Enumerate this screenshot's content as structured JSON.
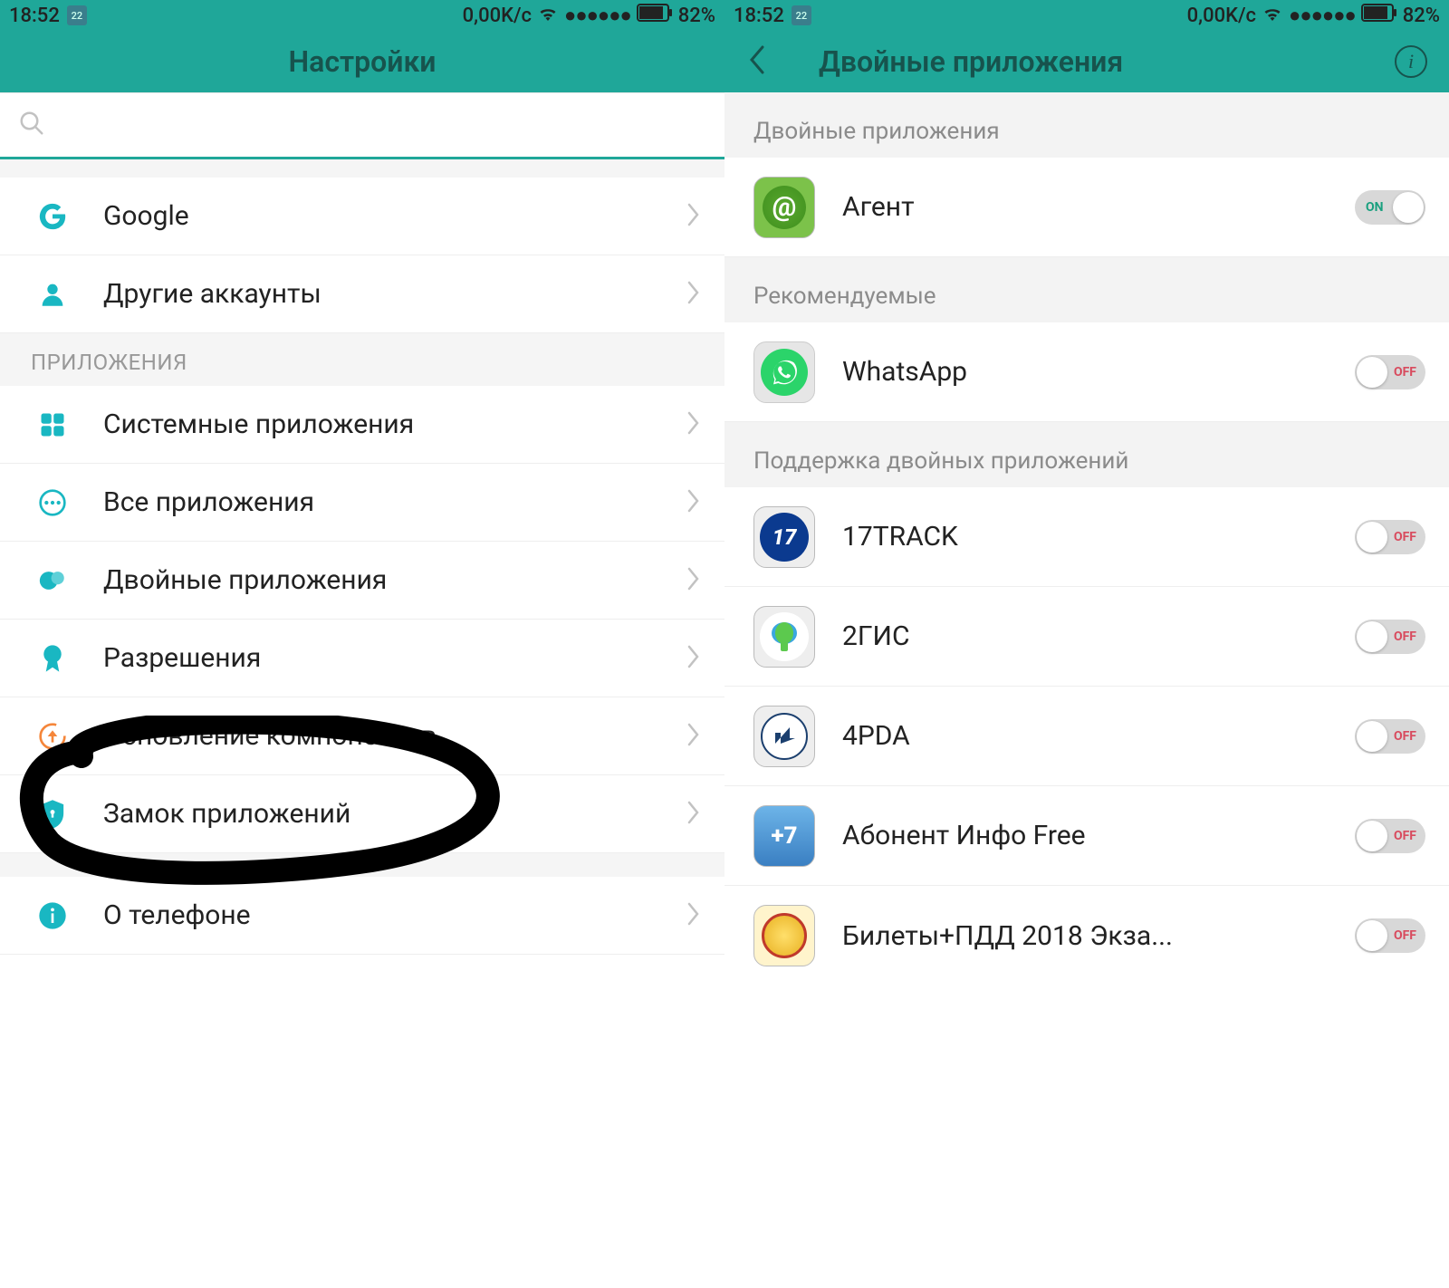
{
  "status": {
    "time": "18:52",
    "cal_day": "22",
    "speed": "0,00K/c",
    "battery": "82%"
  },
  "left": {
    "title": "Настройки",
    "search_placeholder": "",
    "items": [
      {
        "label": "Google"
      },
      {
        "label": "Другие аккаунты"
      }
    ],
    "section_apps": "ПРИЛОЖЕНИЯ",
    "apps": [
      {
        "label": "Системные приложения"
      },
      {
        "label": "Все приложения"
      },
      {
        "label": "Двойные приложения"
      },
      {
        "label": "Разрешения"
      },
      {
        "label": "Обновление компонентов"
      },
      {
        "label": "Замок приложений"
      },
      {
        "label": "О телефоне"
      }
    ]
  },
  "right": {
    "title": "Двойные приложения",
    "sections": {
      "dual": "Двойные приложения",
      "recommended": "Рекомендуемые",
      "supported": "Поддержка двойных приложений"
    },
    "apps": {
      "agent": {
        "label": "Агент",
        "state": "ON"
      },
      "whatsapp": {
        "label": "WhatsApp",
        "state": "OFF"
      },
      "track17": {
        "label": "17TRACK",
        "state": "OFF"
      },
      "gis2": {
        "label": "2ГИС",
        "state": "OFF"
      },
      "pda4": {
        "label": "4PDA",
        "state": "OFF"
      },
      "abonent": {
        "label": "Абонент Инфо Free",
        "state": "OFF"
      },
      "pdd": {
        "label": "Билеты+ПДД 2018 Экза...",
        "state": "OFF"
      }
    }
  }
}
